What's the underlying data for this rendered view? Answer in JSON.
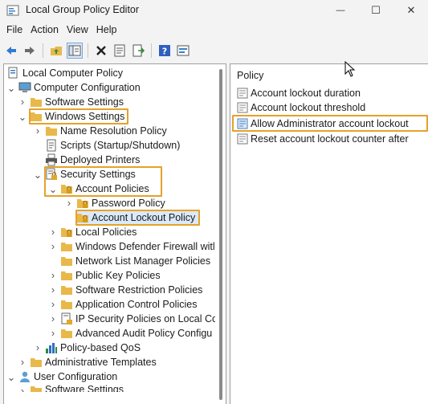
{
  "window": {
    "title": "Local Group Policy Editor",
    "minimize_glyph": "—",
    "maximize_glyph": "☐",
    "close_glyph": "✕"
  },
  "menu": [
    "File",
    "Action",
    "View",
    "Help"
  ],
  "toolbar": {
    "buttons": [
      "back-icon",
      "forward-icon",
      "up-folder-icon",
      "show-tree-icon",
      "delete-icon",
      "properties-icon",
      "export-icon",
      "help-icon",
      "filter-icon"
    ]
  },
  "tree": {
    "root": "Local Computer Policy",
    "computer_config": "Computer Configuration",
    "software_settings": "Software Settings",
    "windows_settings": "Windows Settings",
    "name_resolution": "Name Resolution Policy",
    "scripts": "Scripts (Startup/Shutdown)",
    "deployed_printers": "Deployed Printers",
    "security_settings": "Security Settings",
    "account_policies": "Account Policies",
    "password_policy": "Password Policy",
    "account_lockout_policy": "Account Lockout Policy",
    "local_policies": "Local Policies",
    "defender_firewall": "Windows Defender Firewall witl",
    "network_list": "Network List Manager Policies",
    "public_key": "Public Key Policies",
    "software_restriction": "Software Restriction Policies",
    "application_control": "Application Control Policies",
    "ip_security": "IP Security Policies on Local Co",
    "advanced_audit": "Advanced Audit Policy Configu",
    "policy_qos": "Policy-based QoS",
    "admin_templates": "Administrative Templates",
    "user_config": "User Configuration",
    "user_software_settings": "Software Settings"
  },
  "policy_list": {
    "column_header": "Policy",
    "items": [
      "Account lockout duration",
      "Account lockout threshold",
      "Allow Administrator account lockout",
      "Reset account lockout counter after"
    ]
  },
  "colors": {
    "highlight": "#e6a12b",
    "folder": "#e8b84a",
    "selection_bg": "#dbe9f8"
  }
}
